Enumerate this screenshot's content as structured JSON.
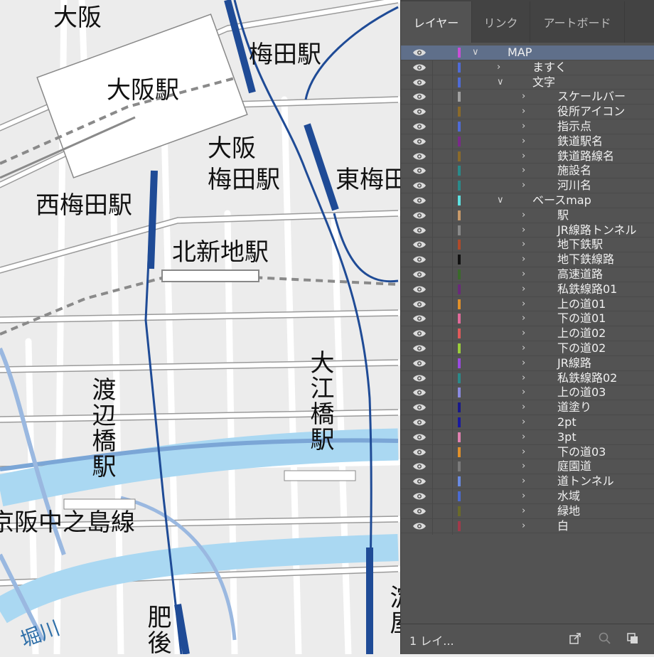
{
  "map": {
    "labels": {
      "osaka": "大阪",
      "osaka_station": "大阪駅",
      "umeda_station": "梅田駅",
      "osaka_umeda_station_1": "大阪",
      "osaka_umeda_station_2": "梅田駅",
      "higashi_umeda_station": "東梅田",
      "nishi_umeda_station": "西梅田駅",
      "kitashinchi_station": "北新地駅",
      "watanabebashi_station": "渡辺橋駅",
      "oebashi_station": "大江橋駅",
      "keihan_nakanoshima_line": "京阪中之島線",
      "higo_station_partial": "肥後",
      "yodoyabashi_partial": "淀屋",
      "river_partial": "堀川"
    }
  },
  "panel": {
    "tabs": [
      "レイヤー",
      "リンク",
      "アートボード"
    ],
    "active_tab": "レイヤー",
    "layers": [
      {
        "name": "MAP",
        "depth": 0,
        "expanded": true,
        "color": "#c84fd6",
        "selected": true
      },
      {
        "name": "ますく",
        "depth": 1,
        "expanded": false,
        "color": "#4f6bd6"
      },
      {
        "name": "文字",
        "depth": 1,
        "expanded": true,
        "color": "#4f6bd6"
      },
      {
        "name": "スケールバー",
        "depth": 2,
        "expanded": false,
        "color": "#a0a0a0"
      },
      {
        "name": "役所アイコン",
        "depth": 2,
        "expanded": false,
        "color": "#8a6a2a"
      },
      {
        "name": "指示点",
        "depth": 2,
        "expanded": false,
        "color": "#4f6bd6"
      },
      {
        "name": "鉄道駅名",
        "depth": 2,
        "expanded": false,
        "color": "#7a2a8a"
      },
      {
        "name": "鉄道路線名",
        "depth": 2,
        "expanded": false,
        "color": "#8a6a2a"
      },
      {
        "name": "施設名",
        "depth": 2,
        "expanded": false,
        "color": "#2a8a8a"
      },
      {
        "name": "河川名",
        "depth": 2,
        "expanded": false,
        "color": "#2a8a8a"
      },
      {
        "name": "ベースmap",
        "depth": 1,
        "expanded": true,
        "color": "#5ee0e0"
      },
      {
        "name": "駅",
        "depth": 2,
        "expanded": false,
        "color": "#c89a6a"
      },
      {
        "name": "JR線路トンネル",
        "depth": 2,
        "expanded": false,
        "color": "#888888"
      },
      {
        "name": "地下鉄駅",
        "depth": 2,
        "expanded": false,
        "color": "#b04a2a"
      },
      {
        "name": "地下鉄線路",
        "depth": 2,
        "expanded": false,
        "color": "#111111"
      },
      {
        "name": "高速道路",
        "depth": 2,
        "expanded": false,
        "color": "#3a6a2a"
      },
      {
        "name": "私鉄線路01",
        "depth": 2,
        "expanded": false,
        "color": "#6a2a7a"
      },
      {
        "name": "上の道01",
        "depth": 2,
        "expanded": false,
        "color": "#e0902a"
      },
      {
        "name": "下の道01",
        "depth": 2,
        "expanded": false,
        "color": "#e06a9a"
      },
      {
        "name": "上の道02",
        "depth": 2,
        "expanded": false,
        "color": "#e05a5a"
      },
      {
        "name": "下の道02",
        "depth": 2,
        "expanded": false,
        "color": "#9acc3a"
      },
      {
        "name": "JR線路",
        "depth": 2,
        "expanded": false,
        "color": "#9a4ae0"
      },
      {
        "name": "私鉄線路02",
        "depth": 2,
        "expanded": false,
        "color": "#2a8a8a"
      },
      {
        "name": "上の道03",
        "depth": 2,
        "expanded": false,
        "color": "#8a8ae0"
      },
      {
        "name": "道塗り",
        "depth": 2,
        "expanded": false,
        "color": "#1a1a8a"
      },
      {
        "name": "2pt",
        "depth": 2,
        "expanded": false,
        "color": "#1a1aa0"
      },
      {
        "name": "3pt",
        "depth": 2,
        "expanded": false,
        "color": "#e080b0"
      },
      {
        "name": "下の道03",
        "depth": 2,
        "expanded": false,
        "color": "#e0902a"
      },
      {
        "name": "庭園道",
        "depth": 2,
        "expanded": false,
        "color": "#7a7a7a"
      },
      {
        "name": "道トンネル",
        "depth": 2,
        "expanded": false,
        "color": "#6a8ae0"
      },
      {
        "name": "水域",
        "depth": 2,
        "expanded": false,
        "color": "#4a6ad0"
      },
      {
        "name": "緑地",
        "depth": 2,
        "expanded": false,
        "color": "#6a6a2a"
      },
      {
        "name": "白",
        "depth": 2,
        "expanded": false,
        "color": "#a03a4a"
      }
    ],
    "footer": {
      "count": "1 レイ..."
    }
  }
}
